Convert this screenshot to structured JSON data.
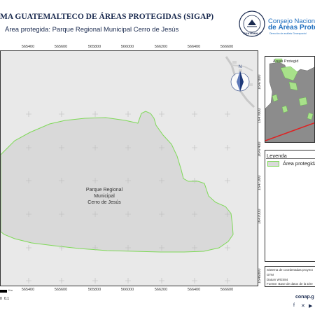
{
  "header": {
    "title": "MA GUATEMALTECO DE ÁREAS PROTEGIDAS (SIGAP)",
    "subtitle": "Área protegida: Parque Regional Municipal Cerro de Jesús",
    "conap_line1": "Consejo Nacional",
    "conap_line2": "de Áreas Protegi",
    "conap_line3": "Dirección de análisis Geoespacial",
    "seal_text": "GUATEMALA"
  },
  "map": {
    "area_label_line1": "Parque Regional",
    "area_label_line2": "Municipal",
    "area_label_line3": "Cerro de Jesús",
    "north_label": "N",
    "x_coords_top": [
      "565400",
      "565600",
      "565800",
      "566000",
      "566200",
      "566400",
      "566600",
      "566800"
    ],
    "x_coords_bottom": [
      "565400",
      "565600",
      "565800",
      "566000",
      "566200",
      "566400",
      "566600",
      "566800"
    ],
    "y_coords_right": [
      "1647800",
      "1647600",
      "1647400",
      "1647200",
      "1647000",
      "1646800"
    ],
    "scale_unit": "Km",
    "scale_zero": "0",
    "scale_max": "0.1",
    "fill_color": "#d9d9d9",
    "border_color": "#7ed957",
    "background_color": "#e9e9e9"
  },
  "inset": {
    "legend_label": "Áreas Protegid"
  },
  "legend": {
    "title": "Leyenda",
    "item_label": "Área protegida"
  },
  "info": {
    "line1": "Sistema de coordenadas proyect",
    "line2": "GTM",
    "line3": "Datum WGS84",
    "line4": "Fuente: Base de datos de la Dire"
  },
  "footer": {
    "website": "conap.g",
    "social_icons": [
      "facebook-icon",
      "x-icon",
      "youtube-icon",
      "instagram-icon"
    ]
  }
}
